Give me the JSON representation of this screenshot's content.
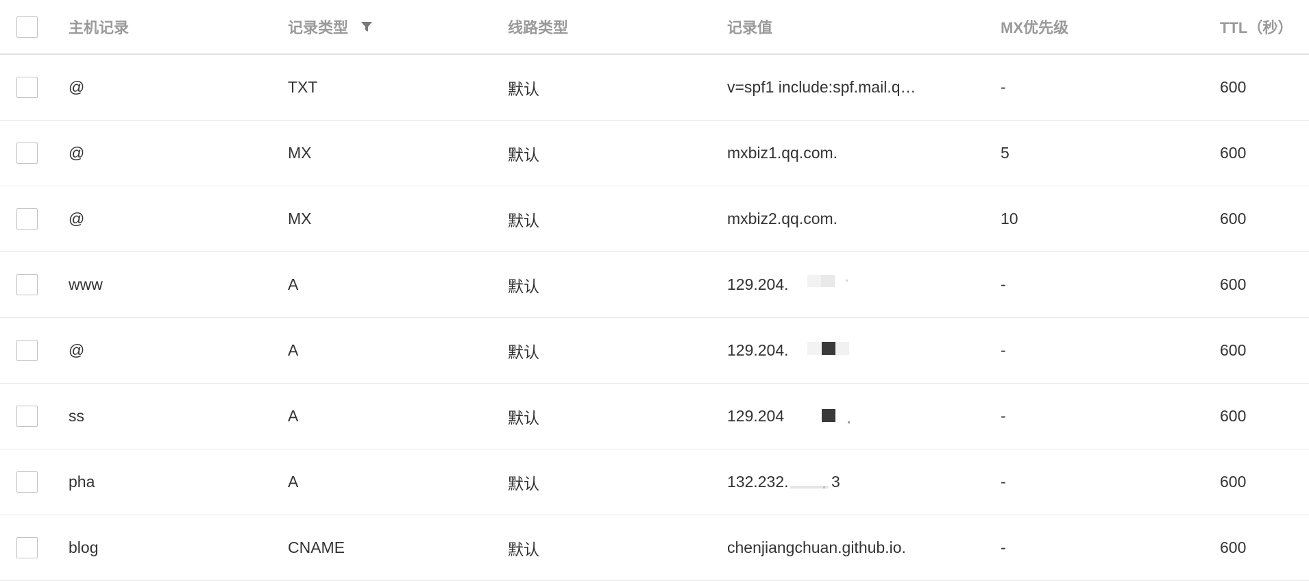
{
  "table": {
    "columns": {
      "host": "主机记录",
      "type": "记录类型",
      "line": "线路类型",
      "value": "记录值",
      "mx_priority": "MX优先级",
      "ttl": "TTL（秒）"
    },
    "rows": [
      {
        "host": "@",
        "type": "TXT",
        "line": "默认",
        "value": "v=spf1 include:spf.mail.q…",
        "mx_priority": "-",
        "ttl": "600"
      },
      {
        "host": "@",
        "type": "MX",
        "line": "默认",
        "value": "mxbiz1.qq.com.",
        "mx_priority": "5",
        "ttl": "600"
      },
      {
        "host": "@",
        "type": "MX",
        "line": "默认",
        "value": "mxbiz2.qq.com.",
        "mx_priority": "10",
        "ttl": "600"
      },
      {
        "host": "www",
        "type": "A",
        "line": "默认",
        "value": "129.204.",
        "mx_priority": "-",
        "ttl": "600"
      },
      {
        "host": "@",
        "type": "A",
        "line": "默认",
        "value": "129.204.",
        "mx_priority": "-",
        "ttl": "600"
      },
      {
        "host": "ss",
        "type": "A",
        "line": "默认",
        "value": "129.204",
        "mx_priority": "-",
        "ttl": "600"
      },
      {
        "host": "pha",
        "type": "A",
        "line": "默认",
        "value": "132.232.",
        "value_suffix": "3",
        "mx_priority": "-",
        "ttl": "600"
      },
      {
        "host": "blog",
        "type": "CNAME",
        "line": "默认",
        "value": "chenjiangchuan.github.io.",
        "mx_priority": "-",
        "ttl": "600"
      }
    ]
  },
  "icons": {
    "filter": "filter-icon",
    "checkbox": "checkbox"
  },
  "colors": {
    "header_text": "#9a9a9a",
    "body_text": "#333333",
    "divider": "#e8e8e8",
    "checkbox_border": "#c2c2c2",
    "filter_icon": "#7a7a7a"
  }
}
